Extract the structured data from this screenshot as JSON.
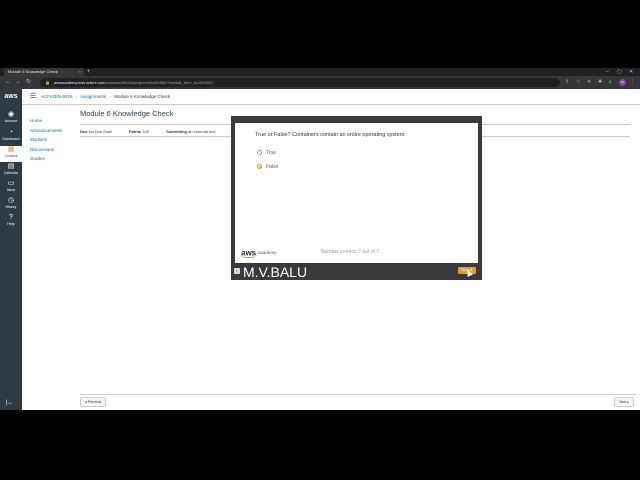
{
  "browser": {
    "tab_title": "Module 6 Knowledge Check",
    "tab_close": "×",
    "new_tab": "+",
    "url_host": "awsacademy.instructure.com",
    "url_path": "/courses/9818/assignments/84986?module_item_id=892683",
    "profile_initials": "M",
    "win_min": "–",
    "win_max": "▢",
    "win_close": "✕"
  },
  "global_nav": {
    "logo": "aws",
    "items": [
      {
        "label": "Account",
        "icon": "account-icon",
        "glyph": "◉"
      },
      {
        "label": "Dashboard",
        "icon": "dashboard-icon",
        "glyph": "◔"
      },
      {
        "label": "Courses",
        "icon": "courses-icon",
        "glyph": "▦"
      },
      {
        "label": "Calendar",
        "icon": "calendar-icon",
        "glyph": "▤"
      },
      {
        "label": "Inbox",
        "icon": "inbox-icon",
        "glyph": "▭"
      },
      {
        "label": "History",
        "icon": "history-icon",
        "glyph": "◷"
      },
      {
        "label": "Help",
        "icon": "help-icon",
        "glyph": "?"
      }
    ],
    "collapse": "|←"
  },
  "breadcrumb": {
    "course": "ACFv2EN-9818",
    "section": "Assignments",
    "current": "Module 6 Knowledge Check",
    "sep": "›"
  },
  "course_nav": [
    "Home",
    "Announcements",
    "Modules",
    "Discussions",
    "Grades"
  ],
  "assignment": {
    "title": "Module 6 Knowledge Check",
    "due_label": "Due",
    "due_value": "No Due Date",
    "points_label": "Points",
    "points_value": "100",
    "submitting_label": "Submitting",
    "submitting_value": "an external tool"
  },
  "quiz": {
    "question": "True or False? Containers contain an entire operating system.",
    "options": [
      "True",
      "False"
    ],
    "selected": "False",
    "brand_aws": "aws",
    "brand_academy": "academy",
    "score_text": "Number correct: 7 out of 7",
    "submit_label": "Submit",
    "watermark": "M.V.BALU"
  },
  "footer": {
    "previous": "◂ Previous",
    "next": "Next ▸"
  },
  "colors": {
    "nav_bg": "#2d3b45",
    "link": "#0770a3",
    "accent": "#e8962e"
  }
}
